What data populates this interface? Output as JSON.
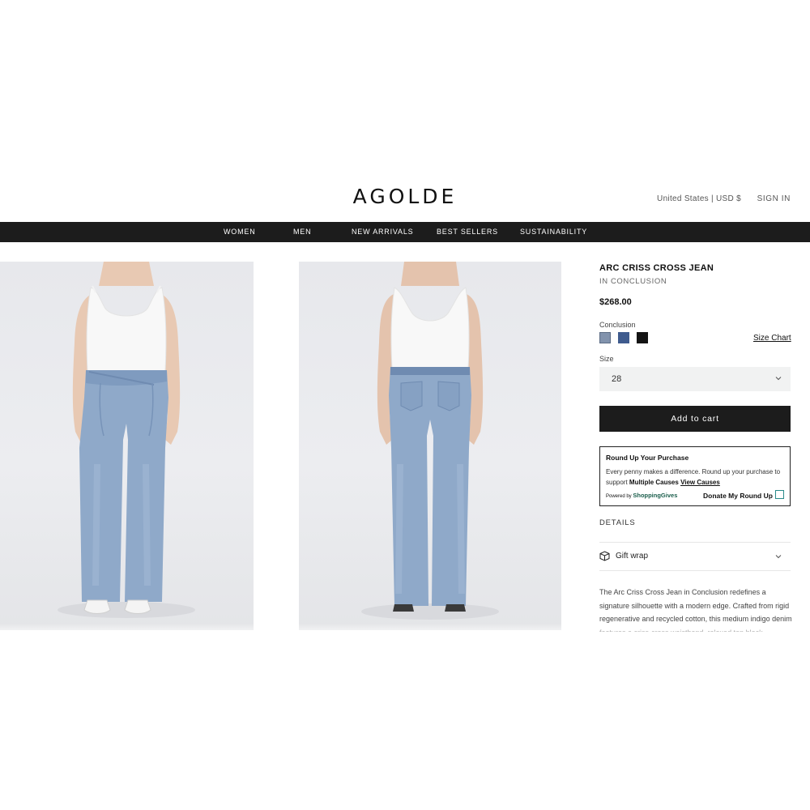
{
  "header": {
    "logo": "AGOLDE",
    "locale": "United States | USD $",
    "sign_in": "SIGN IN"
  },
  "nav": {
    "items": [
      {
        "label": "WOMEN"
      },
      {
        "label": "MEN"
      },
      {
        "label": "NEW ARRIVALS"
      },
      {
        "label": "BEST SELLERS"
      },
      {
        "label": "SUSTAINABILITY"
      }
    ]
  },
  "product": {
    "title": "ARC CRISS CROSS JEAN",
    "color_name": "IN CONCLUSION",
    "price": "$268.00",
    "color_label": "Conclusion",
    "swatches": [
      {
        "color": "#8293ad",
        "selected": true
      },
      {
        "color": "#3f5b8e",
        "selected": false
      },
      {
        "color": "#141414",
        "selected": false
      }
    ],
    "size_chart": "Size Chart",
    "size_label": "Size",
    "size_value": "28",
    "add_to_cart": "Add to cart"
  },
  "roundup": {
    "title": "Round Up Your Purchase",
    "text_lead": "Every penny makes a difference. Round up your purchase to support",
    "causes": "Multiple Causes",
    "view_causes": "View Causes",
    "powered_prefix": "Powered by",
    "powered_brand": "ShoppingGives",
    "donate_label": "Donate My Round Up",
    "donate_checked": false
  },
  "details": {
    "heading": "DETAILS",
    "gift_wrap": "Gift wrap",
    "description": "The Arc Criss Cross Jean in Conclusion redefines a signature silhouette with a modern edge. Crafted from rigid regenerative and recycled cotton, this medium indigo denim features a criss-cross waistband, relaxed top block"
  },
  "colors": {
    "nav_bg": "#1c1c1c",
    "button_bg": "#1c1c1c",
    "accent_green": "#1b5e4c",
    "checkbox_border": "#2a8a8a"
  }
}
